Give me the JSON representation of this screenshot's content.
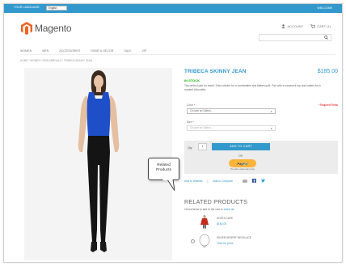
{
  "topbar": {
    "language_label": "YOUR LANGUAGE:",
    "language_value": "English",
    "welcome": "WELCOME"
  },
  "header": {
    "logo_text": "Magento",
    "account_label": "ACCOUNT",
    "cart_label": "CART (1)",
    "search_placeholder": ""
  },
  "nav": {
    "items": [
      "WOMEN",
      "MEN",
      "ACCESSORIES",
      "HOME & DECOR",
      "SALE",
      "VIP"
    ]
  },
  "breadcrumb": "HOME / WOMEN / NEW ARRIVALS / TRIBECA SKINNY JEAN",
  "product": {
    "name": "TRIBECA SKINNY JEAN",
    "price": "$185.00",
    "stock": "IN STOCK",
    "description": "The perfect pair for travel. Extra stretch for a comfortable and flattering fit. Pair with a crewneck top and loafers for a modern silhouette.",
    "color_label": "Color",
    "size_label": "Size",
    "required_note": "* Required Fields",
    "color_select": "Choose an Option...",
    "size_select": "Choose an Option...",
    "qty_label": "Qty",
    "qty_value": "1",
    "add_to_cart": "ADD TO CART",
    "or_label": "OR",
    "paypal_a": "Pay",
    "paypal_b": "Pal",
    "paypal_sub": "The safer, easier way to pay",
    "wishlist_link": "Add to Wishlist",
    "compare_link": "Add to Compare"
  },
  "related": {
    "title": "RELATED PRODUCTS",
    "hint_prefix": "Check items to add to the cart or ",
    "hint_link": "select all",
    "items": [
      {
        "name": "HOSTA CAPE",
        "price": "$150.00"
      },
      {
        "name": "SILVER DESERT NECKLACE",
        "price": "Click for price"
      }
    ]
  },
  "callout": {
    "text_line1": "Related",
    "text_line2": "Products"
  },
  "colors": {
    "accent": "#3399cc",
    "stock": "#11b400",
    "paypal": "#fbb43a"
  }
}
